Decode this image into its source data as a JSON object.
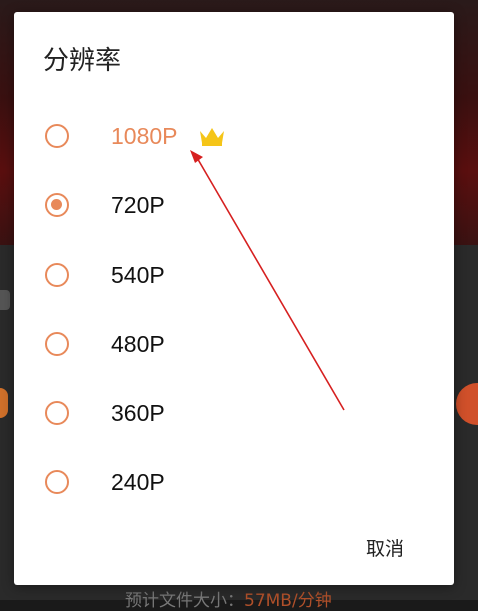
{
  "dialog": {
    "title": "分辨率",
    "options": [
      {
        "label": "1080P",
        "selected": false,
        "premium": true,
        "badge_icon": "crown-icon"
      },
      {
        "label": "720P",
        "selected": true,
        "premium": false
      },
      {
        "label": "540P",
        "selected": false,
        "premium": false
      },
      {
        "label": "480P",
        "selected": false,
        "premium": false
      },
      {
        "label": "360P",
        "selected": false,
        "premium": false
      },
      {
        "label": "240P",
        "selected": false,
        "premium": false
      }
    ],
    "cancel_label": "取消"
  },
  "background": {
    "footer_text_prefix": "预计文件大小：",
    "footer_text_value": "57MB/分钟"
  },
  "colors": {
    "accent": "#e8895a",
    "crown": "#f5c518",
    "annotation_arrow": "#d62020"
  }
}
